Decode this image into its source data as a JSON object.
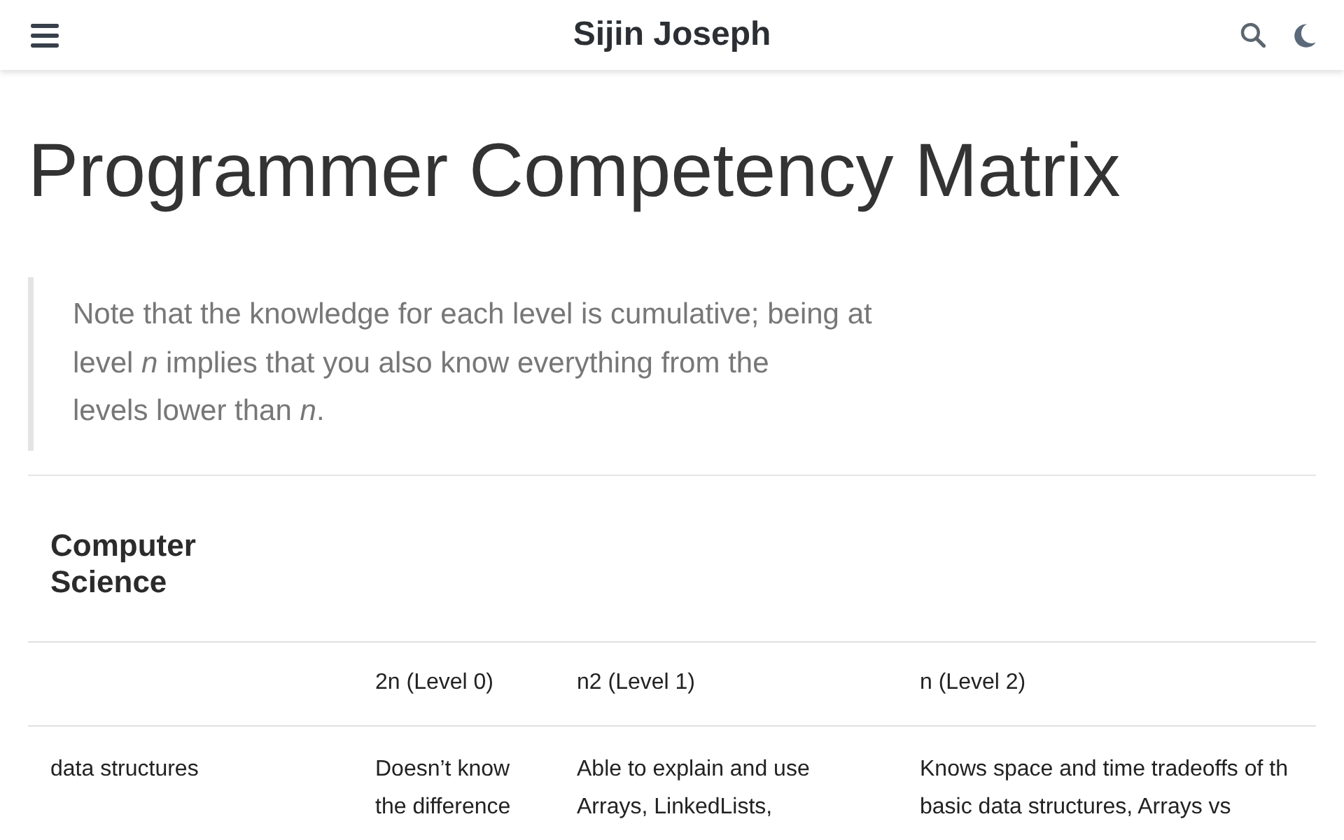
{
  "header": {
    "title": "Sijin Joseph"
  },
  "page": {
    "title": "Programmer Competency Matrix",
    "note": "Note that the knowledge for each level is cumulative; being at\nlevel *n* implies that you also know everything from the\nlevels lower than *n*."
  },
  "table": {
    "section": "Computer Science",
    "columns": [
      "2n (Level 0)",
      "n2 (Level 1)",
      "n (Level 2)"
    ],
    "rows": [
      {
        "name": "data structures",
        "cells": [
          "Doesn’t know\nthe difference",
          "Able to explain and use\nArrays, LinkedLists,",
          "Knows space and time tradeoffs of th\nbasic data structures, Arrays vs"
        ]
      }
    ]
  }
}
